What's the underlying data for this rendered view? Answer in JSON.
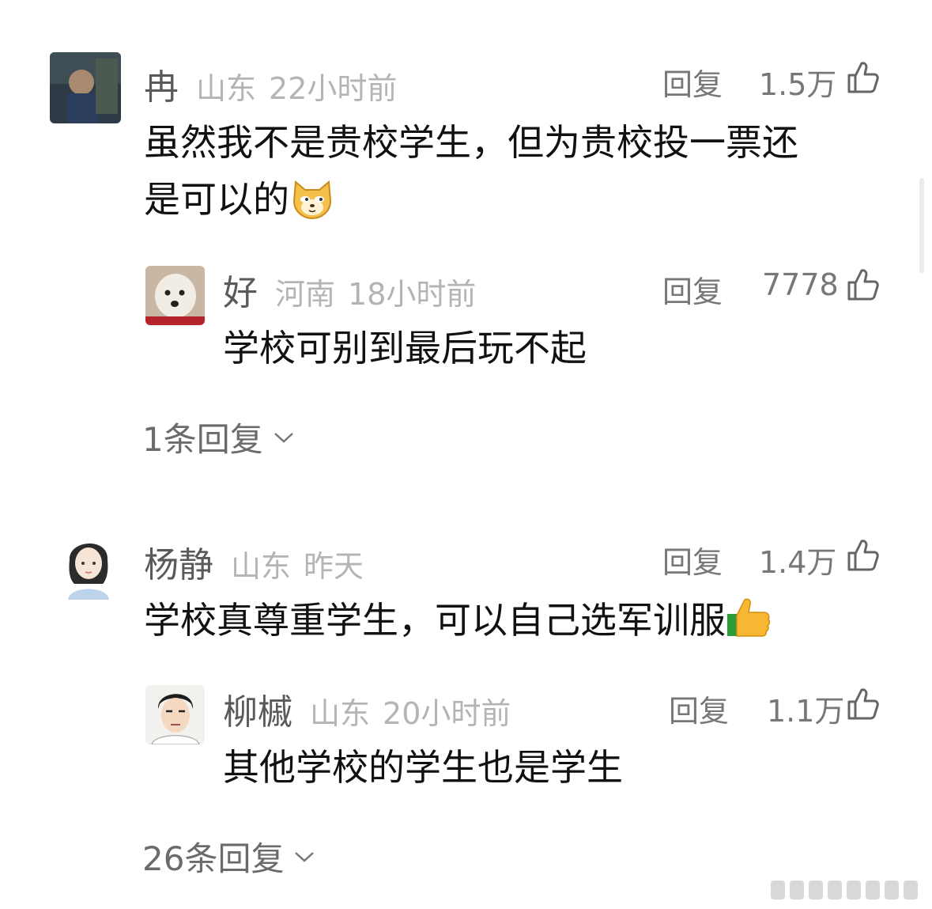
{
  "comments": [
    {
      "name": "冉",
      "location": "山东",
      "time": "22小时前",
      "reply_label": "回复",
      "likes": "1.5万",
      "text_line1": "虽然我不是贵校学生，但为贵校投一票还",
      "text_line2": "是可以的",
      "emoji": "doge-cat-icon",
      "sub_reply": {
        "name": "好",
        "location": "河南",
        "time": "18小时前",
        "reply_label": "回复",
        "likes": "7778",
        "text": "学校可别到最后玩不起"
      },
      "more_replies": "1条回复"
    },
    {
      "name": "杨静",
      "location": "山东",
      "time": "昨天",
      "reply_label": "回复",
      "likes": "1.4万",
      "text_line1": "学校真尊重学生，可以自己选军训服",
      "emoji": "thumbs-up-icon",
      "sub_reply": {
        "name": "柳槭",
        "location": "山东",
        "time": "20小时前",
        "reply_label": "回复",
        "likes": "1.1万",
        "text": "其他学校的学生也是学生"
      },
      "more_replies": "26条回复"
    }
  ],
  "colors": {
    "name": "#5a5a5a",
    "meta": "#b4b4b4",
    "body": "#111111",
    "action": "#777777"
  }
}
